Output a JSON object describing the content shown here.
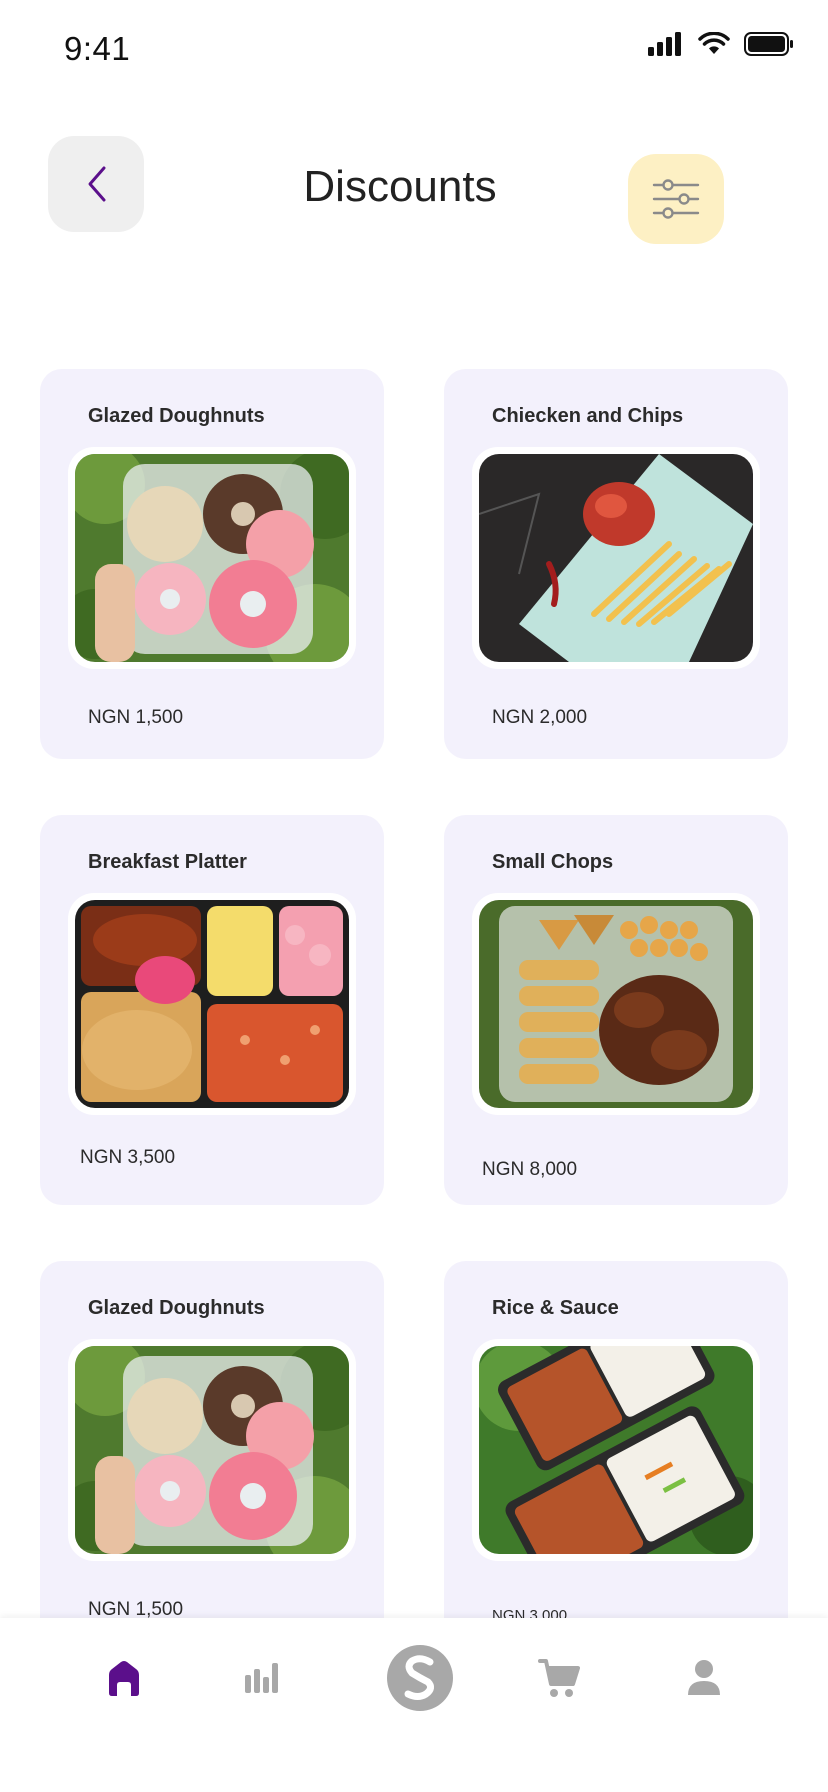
{
  "status_bar": {
    "time": "9:41"
  },
  "header": {
    "title": "Discounts"
  },
  "colors": {
    "accent": "#5b0f8b",
    "card_bg": "#f3f1fc",
    "filter_bg": "#fdf0c4",
    "back_bg": "#efefef",
    "nav_inactive": "#a8a8a8"
  },
  "items": [
    {
      "title": "Glazed Doughnuts",
      "price": "NGN 1,500",
      "image": "glazed-doughnuts-photo"
    },
    {
      "title": "Chiecken and Chips",
      "price": "NGN 2,000",
      "image": "chicken-and-chips-photo"
    },
    {
      "title": "Breakfast Platter",
      "price": "NGN 3,500",
      "image": "breakfast-platter-photo"
    },
    {
      "title": "Small Chops",
      "price": "NGN 8,000",
      "image": "small-chops-photo"
    },
    {
      "title": "Glazed Doughnuts",
      "price": "NGN 1,500",
      "image": "glazed-doughnuts-photo"
    },
    {
      "title": "Rice & Sauce",
      "price": "NGN 3,000",
      "image": "rice-and-sauce-photo"
    }
  ],
  "nav": [
    {
      "name": "home",
      "icon": "home-icon",
      "active": true
    },
    {
      "name": "stats",
      "icon": "bar-chart-icon",
      "active": false
    },
    {
      "name": "brand",
      "icon": "s-logo-icon",
      "active": false
    },
    {
      "name": "cart",
      "icon": "cart-icon",
      "active": false
    },
    {
      "name": "profile",
      "icon": "user-icon",
      "active": false
    }
  ]
}
